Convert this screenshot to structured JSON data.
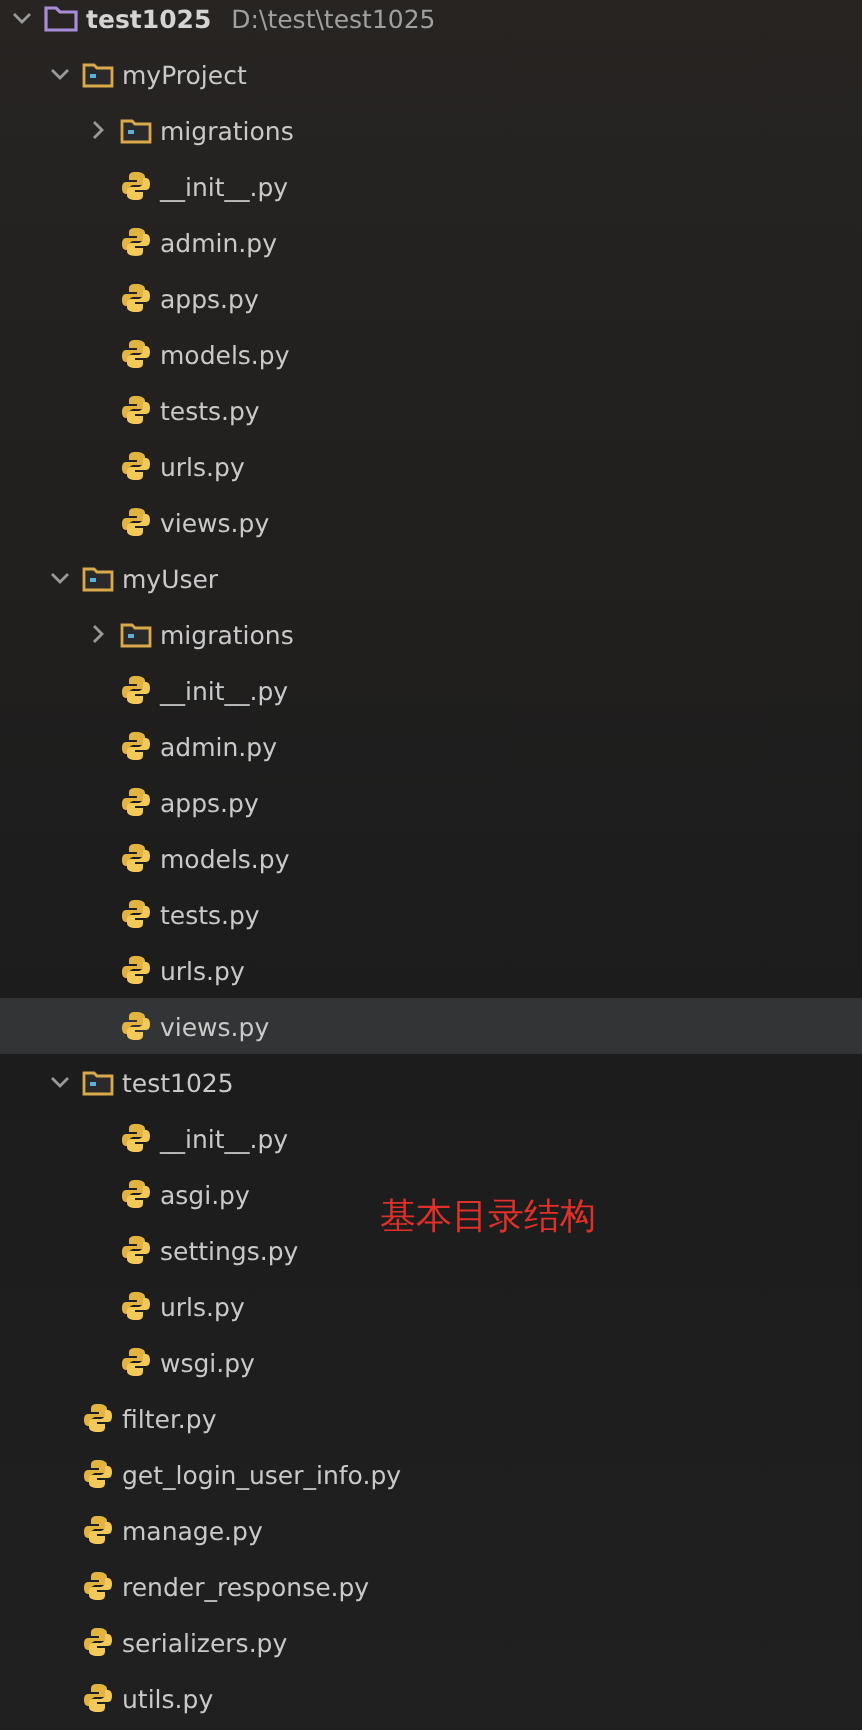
{
  "tree": [
    {
      "name": "test1025",
      "kind": "project",
      "path": "D:\\test\\test1025",
      "expanded": true,
      "selected": false,
      "children": [
        {
          "name": "myProject",
          "kind": "folder",
          "expanded": true,
          "selected": false,
          "children": [
            {
              "name": "migrations",
              "kind": "folder",
              "expanded": false,
              "selected": false
            },
            {
              "name": "__init__.py",
              "kind": "file",
              "selected": false
            },
            {
              "name": "admin.py",
              "kind": "file",
              "selected": false
            },
            {
              "name": "apps.py",
              "kind": "file",
              "selected": false
            },
            {
              "name": "models.py",
              "kind": "file",
              "selected": false
            },
            {
              "name": "tests.py",
              "kind": "file",
              "selected": false
            },
            {
              "name": "urls.py",
              "kind": "file",
              "selected": false
            },
            {
              "name": "views.py",
              "kind": "file",
              "selected": false
            }
          ]
        },
        {
          "name": "myUser",
          "kind": "folder",
          "expanded": true,
          "selected": false,
          "children": [
            {
              "name": "migrations",
              "kind": "folder",
              "expanded": false,
              "selected": false
            },
            {
              "name": "__init__.py",
              "kind": "file",
              "selected": false
            },
            {
              "name": "admin.py",
              "kind": "file",
              "selected": false
            },
            {
              "name": "apps.py",
              "kind": "file",
              "selected": false
            },
            {
              "name": "models.py",
              "kind": "file",
              "selected": false
            },
            {
              "name": "tests.py",
              "kind": "file",
              "selected": false
            },
            {
              "name": "urls.py",
              "kind": "file",
              "selected": false
            },
            {
              "name": "views.py",
              "kind": "file",
              "selected": true
            }
          ]
        },
        {
          "name": "test1025",
          "kind": "folder",
          "expanded": true,
          "selected": false,
          "children": [
            {
              "name": "__init__.py",
              "kind": "file",
              "selected": false
            },
            {
              "name": "asgi.py",
              "kind": "file",
              "selected": false
            },
            {
              "name": "settings.py",
              "kind": "file",
              "selected": false
            },
            {
              "name": "urls.py",
              "kind": "file",
              "selected": false
            },
            {
              "name": "wsgi.py",
              "kind": "file",
              "selected": false
            }
          ]
        },
        {
          "name": "filter.py",
          "kind": "file",
          "selected": false
        },
        {
          "name": "get_login_user_info.py",
          "kind": "file",
          "selected": false
        },
        {
          "name": "manage.py",
          "kind": "file",
          "selected": false
        },
        {
          "name": "render_response.py",
          "kind": "file",
          "selected": false
        },
        {
          "name": "serializers.py",
          "kind": "file",
          "selected": false
        },
        {
          "name": "utils.py",
          "kind": "file",
          "selected": false
        }
      ]
    }
  ],
  "annotation": "基本目录结构"
}
